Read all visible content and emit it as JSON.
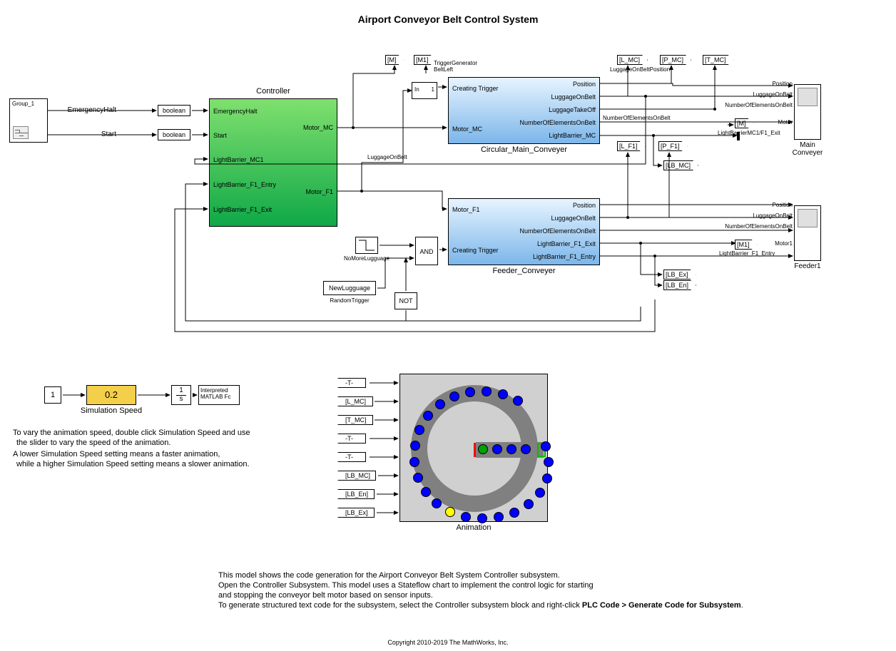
{
  "title": "Airport Conveyor Belt Control System",
  "group": {
    "label": "Group_1"
  },
  "signal_inputs": {
    "emergency_halt": "EmergencyHalt",
    "start": "Start"
  },
  "bool_conv": {
    "b1": "boolean",
    "b2": "boolean"
  },
  "controller": {
    "title": "Controller",
    "in1": "EmergencyHalt",
    "in2": "Start",
    "in3": "LightBarrier_MC1",
    "in4": "LightBarrier_F1_Entry",
    "in5": "LightBarrier_F1_Exit",
    "out1": "Motor_MC",
    "out2": "Motor_F1"
  },
  "tags": {
    "M": "[M]",
    "M1": "[M1]",
    "L_MC": "[L_MC]",
    "P_MC": "[P_MC]",
    "T_MC": "[T_MC]",
    "L_F1": "[L_F1]",
    "P_F1": "[P_F1]",
    "LB_MC": "[LB_MC]",
    "LB_Ex": "[LB_Ex]",
    "LB_En": "[LB_En]",
    "Mout": "[M]",
    "M1out": "[M1]"
  },
  "trigger_gen": {
    "label": "TriggerGenerator\nBeltLeft",
    "in": "In",
    "one": "1"
  },
  "main_conv": {
    "title": "Circular_Main_Conveyer",
    "in1": "Creating Trigger",
    "in2": "Motor_MC",
    "out1": "Position",
    "out2": "LuggageOnBelt",
    "out3": "LuggageTakeOff",
    "out4": "NumberOfElementsOnBelt",
    "out5": "LightBarrier_MC"
  },
  "feed_conv": {
    "title": "Feeder_Conveyer",
    "in1": "Motor_F1",
    "in2": "Creating Trigger",
    "out1": "Position",
    "out2": "LuggageOnBelt",
    "out3": "NumberOfElementsOnBelt",
    "out4": "LightBarrier_F1_Exit",
    "out5": "LightBarrier_F1_Entry"
  },
  "labels": {
    "LOBPosition": "LuggageOnBeltPosition",
    "NumElements": "NumberOfElementsOnBelt",
    "LuggageOnBelt": "LuggageOnBelt",
    "LB_MC1_F1": "LightBarrierMC1/F1_Exit",
    "LB_F1_Entry": "LightBarrier_F1_Entry"
  },
  "scope1": {
    "title": "Main\nConveyer",
    "p1": "Position",
    "p2": "LuggageOnBelt",
    "p3": "NumberOfElementsOnBelt",
    "p4": "Motor"
  },
  "scope2": {
    "title": "Feeder1",
    "p1": "Position",
    "p2": "LuggageOnBelt",
    "p3": "NumberOfElementsOnBelt",
    "p4": "Motor1"
  },
  "logic": {
    "and": "AND",
    "not": "NOT"
  },
  "misc": {
    "nomore": "NoMoreLugguage",
    "newlug": "NewLugguage",
    "rand": "RandomTrigger"
  },
  "sim": {
    "const": "1",
    "speed": "0.2",
    "speed_label": "Simulation Speed",
    "int_num": "1",
    "int_s": "s",
    "matlab": "Interpreted\nMATLAB Fc"
  },
  "help_text_1": "To vary the animation speed, double click Simulation Speed and use",
  "help_text_2": "the slider to vary the speed of the animation.",
  "help_text_3": "A lower Simulation Speed setting means a faster animation,",
  "help_text_4": "while a higher Simulation Speed setting means a slower animation.",
  "anim_tags": {
    "t1": "-T-",
    "t2": "[L_MC]",
    "t3": "[T_MC]",
    "t4": "-T-",
    "t5": "-T-",
    "t6": "[LB_MC]",
    "t7": "[LB_En]",
    "t8": "[LB_Ex]",
    "title": "Animation"
  },
  "desc": {
    "l1": "This model shows the code generation for the Airport Conveyor Belt System Controller subsystem.",
    "l2": "Open the Controller Subsystem. This model uses a Stateflow chart to implement the control logic for starting",
    "l3": " and stopping the conveyor belt motor based on sensor inputs.",
    "l4a": "To generate structured text code for the subsystem, select the Controller subsystem block and right-click ",
    "l4b": "PLC Code > Generate Code for Subsystem",
    "l4c": "."
  },
  "copyright": "Copyright 2010-2019 The MathWorks, Inc."
}
